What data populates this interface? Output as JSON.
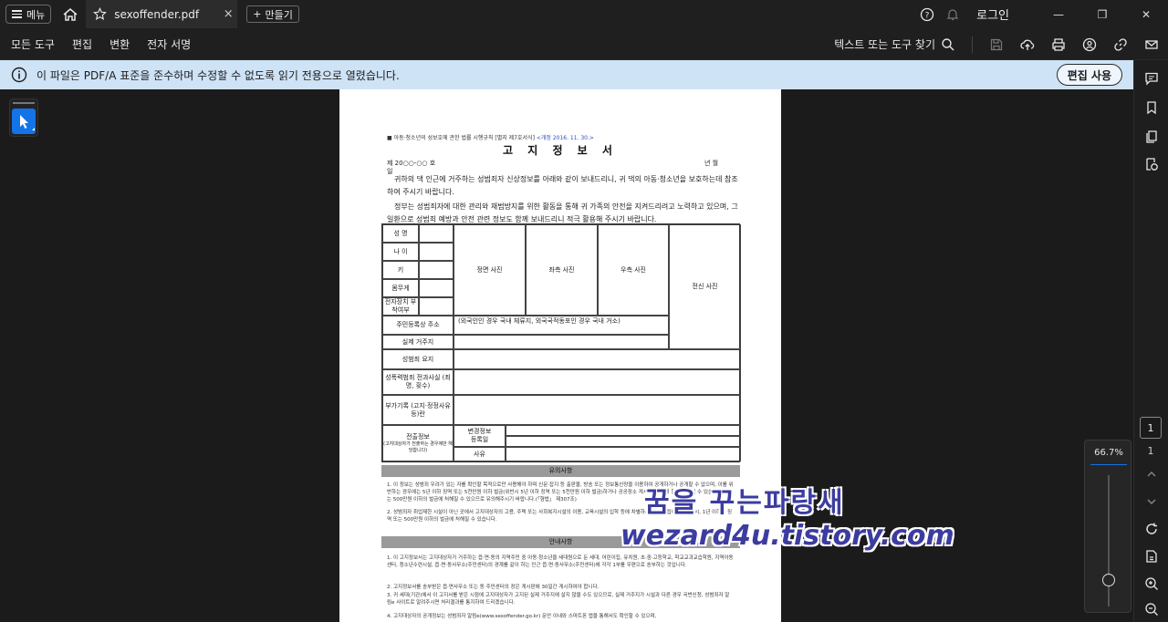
{
  "titlebar": {
    "menu_label": "메뉴",
    "tab_title": "sexoffender.pdf",
    "tab_close": "×",
    "new_label": "만들기",
    "new_plus": "+",
    "login_label": "로그인",
    "minimize": "—",
    "maximize": "❐",
    "close": "✕"
  },
  "toolbar": {
    "tools": [
      "모든 도구",
      "편집",
      "변환",
      "전자 서명"
    ],
    "search_label": "텍스트 또는 도구 찾기"
  },
  "infobar": {
    "message": "이 파일은 PDF/A 표준을 준수하며 수정할 수 없도록 읽기 전용으로 열렸습니다.",
    "edit_button": "편집 사용",
    "color": "#cfe3f7"
  },
  "navigation": {
    "current_page": "1",
    "total_pages": "1",
    "zoom": "66.7%"
  },
  "document": {
    "header": "■ 아동·청소년의 성보호에 관한 법률 시행규칙 [별지 제7호서식]",
    "revision": "<개정 2016. 11. 30.>",
    "title": "고 지 정 보 서",
    "doc_no": "제 20○○-○○ 호",
    "date_label": "년        월",
    "day_label": "일",
    "para1": "귀하의 댁 인근에 거주하는 성범죄자 신상정보를 아래와 같이 보내드리니, 귀 댁의 아동·청소년을 보호하는데 참조하여 주시기 바랍니다.",
    "para2": "정부는 성범죄자에 대한 관리와 재범방지를 위한 활동을 통해 귀 가족의 안전을 지켜드리려고 노력하고 있으며, 그 일환으로 성범죄 예방과 안전 관련 정보도 함께 보내드리니 적극 활용해 주시기 바랍니다.",
    "form": {
      "name": "성 명",
      "age": "나 이",
      "height": "키",
      "weight": "몸무게",
      "device": "전자장치 부착여부",
      "photo_front": "정면 사진",
      "photo_left": "좌측 사진",
      "photo_right": "우측 사진",
      "photo_full": "전신 사진",
      "registered_addr": "주민등록상 주소",
      "registered_addr_note": "(외국인인 경우 국내 체류지, 외국국적동포인 경우 국내 거소)",
      "actual_addr": "실제 거주지",
      "crime_summary": "성범죄 요지",
      "crime_history": "성폭력범죄 전과사실 (죄명, 횟수)",
      "additional": "부가기록 (고지·정정사유 등)란",
      "transfer_info": "전출정보",
      "transfer_note": "(고지대상자가 전출하는 경우에만 해당합니다)",
      "changed_info": "변경정보",
      "reg_date": "등록일",
      "reason": "사유"
    },
    "caution_title": "유의사항",
    "caution1": "1. 이 정보는 성범죄 우려가 있는 자를 확인할 목적으로만 사용해야 하며 신문·잡지 등 출판물, 방송 또는 정보통신망을 이용하여 공개하거나 공개할 수 없으며, 이를 위반하는 경우에는 5년 이하 징역 또는 5천만원 이하 벌금(위반시 5년 이하 징역 또는 5천만원 이하 벌금)하거나 공공장소 게시 등을 통해 형에 처해질 수 있습니다. 또는 500만원 이하의 벌금에 처해질 수 있으므로 유의해주시기 바랍니다.(「형법」 제307조)",
    "caution2": "2. 성범죄자 취업제한 시설이 아닌 곳에서 고지대상자의 고용, 주택 또는 사회복지시설의 이용, 교육시설의 입학 등에 차별하셔서는 안 됩니다. 위반 시, 1년 이하의 징역 또는 500만원 이하의 벌금에 처해질 수 있습니다.",
    "guide_title": "안내사항",
    "guide1": "1. 이 고지정보서는 고지대상자가 거주하는 읍·면·동의 지역주민 중 아동·청소년을 세대원으로 둔 세대, 어린이집, 유치원, 초·중·고등학교, 학교교과교습학원, 지역아동센터, 청소년수련시설, 읍·면·동사무소(주민센터)의 경계를 같이 하는 인근 읍·면·동사무소(주민센터)에 각각 1부를 우편으로 송부하는 것입니다.",
    "guide2": "2. 고지정보서를 송부받은 읍·면사무소 또는 동 주민센터의 장은 게시판에 30일간 게시하여야 합니다.",
    "guide3": "3. 귀 세대(기관)에서 이 고지서를 받은 시점에 고지대상자가 고지된 실제 거주지에 살지 않을 수도 있으므로, 실제 거주지가 시설과 다른 경우 국번신청, 성범죄자 알림e 사이트로 알려주시면 처리결과를 통지하여 드리겠습니다.",
    "guide4": "4. 고지대상자의 공개정보는 성범죄자 알림e(www.sexoffender.go.kr) 문안 이내와 스마트폰 앱을 통해서도 확인할 수 있으며,"
  },
  "watermark": {
    "line1": "꿈을 꾸는파랑새",
    "line2": "wezard4u.tistory.com"
  }
}
